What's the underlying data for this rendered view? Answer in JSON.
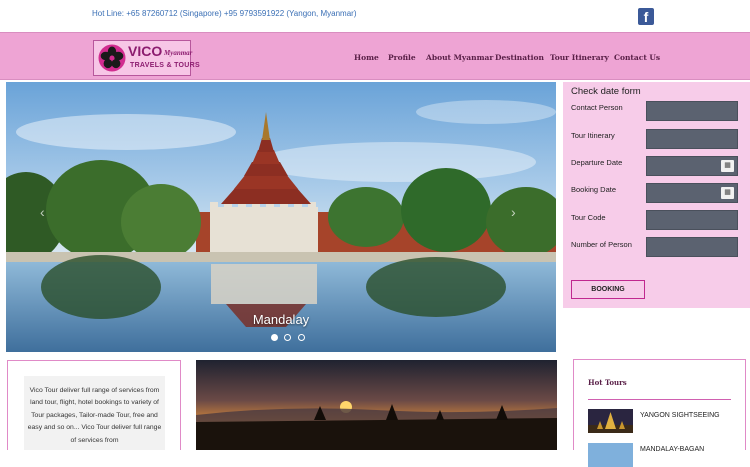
{
  "topbar": {
    "hotline": "Hot Line: +65 87260712 (Singapore)   +95 9793591922 (Yangon, Myanmar)",
    "facebook_icon": "facebook-icon"
  },
  "logo": {
    "name": "VICO",
    "subname": "Myanmar",
    "tagline": "TRAVELS & TOURS"
  },
  "nav": {
    "items": [
      "Home",
      "Profile",
      "About Myanmar",
      "Destination",
      "Tour Itinerary",
      "Contact Us"
    ]
  },
  "hero": {
    "caption": "Mandalay",
    "slides": 3,
    "active_slide": 1,
    "prev_icon": "chevron-left-icon",
    "next_icon": "chevron-right-icon"
  },
  "form": {
    "title": "Check date form",
    "fields": [
      {
        "label": "Contact Person",
        "type": "text"
      },
      {
        "label": "Tour Itinerary",
        "type": "text"
      },
      {
        "label": "Departure Date",
        "type": "date"
      },
      {
        "label": "Booking Date",
        "type": "date"
      },
      {
        "label": "Tour Code",
        "type": "text"
      },
      {
        "label": "Number of Person",
        "type": "text"
      }
    ],
    "submit_label": "BOOKING"
  },
  "about": {
    "text": "Vico Tour deliver full range of services from land tour, flight, hotel bookings to variety of Tour packages, Tailor-made Tour, free and easy and so on... Vico Tour deliver full range of services from"
  },
  "hot_tours": {
    "title": "Hot Tours",
    "items": [
      "YANGON SIGHTSEEING",
      "MANDALAY-BAGAN"
    ]
  },
  "colors": {
    "nav_pink": "#eea4d4",
    "form_pink": "#f7cce9",
    "accent_magenta": "#c0288f",
    "input_gray": "#5b6270",
    "link_blue": "#3a6fb5",
    "facebook_blue": "#3b5998"
  }
}
